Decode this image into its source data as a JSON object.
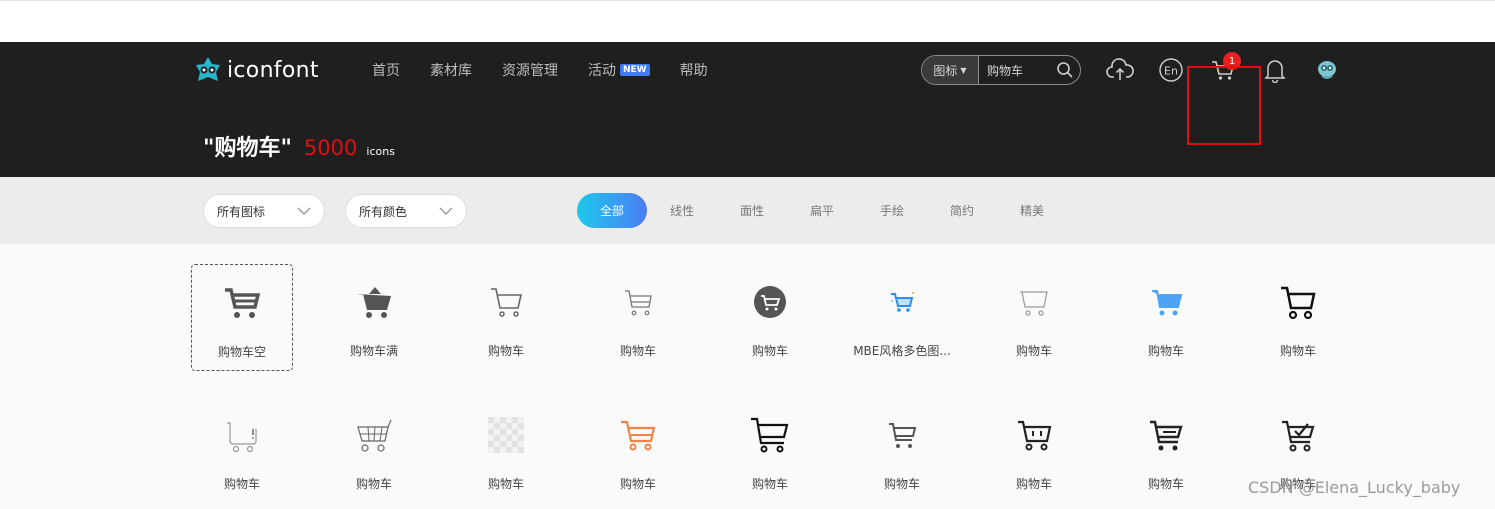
{
  "header": {
    "logo_text": "iconfont",
    "nav": [
      {
        "label": "首页"
      },
      {
        "label": "素材库"
      },
      {
        "label": "资源管理"
      },
      {
        "label": "活动",
        "badge": "NEW"
      },
      {
        "label": "帮助"
      }
    ],
    "search": {
      "type_label": "图标",
      "value": "购物车"
    },
    "icons": [
      "upload-icon",
      "language-en-icon",
      "cart-icon",
      "bell-icon",
      "avatar"
    ],
    "cart_count": "1",
    "language_label": "En"
  },
  "query": {
    "term": "\"购物车\"",
    "count": "5000",
    "unit": "icons"
  },
  "filters": {
    "dropdown_icons": "所有图标",
    "dropdown_colors": "所有颜色",
    "tabs": [
      {
        "label": "全部",
        "active": true
      },
      {
        "label": "线性"
      },
      {
        "label": "面性"
      },
      {
        "label": "扁平"
      },
      {
        "label": "手绘"
      },
      {
        "label": "简约"
      },
      {
        "label": "精美"
      }
    ]
  },
  "results": [
    {
      "name": "购物车空",
      "icon": "cart-empty-icon"
    },
    {
      "name": "购物车满",
      "icon": "cart-full-icon"
    },
    {
      "name": "购物车",
      "icon": "cart-outline-icon"
    },
    {
      "name": "购物车",
      "icon": "cart-thin-icon"
    },
    {
      "name": "购物车",
      "icon": "cart-circle-icon"
    },
    {
      "name": "MBE风格多色图...",
      "icon": "cart-mbe-icon"
    },
    {
      "name": "购物车",
      "icon": "cart-light-icon"
    },
    {
      "name": "购物车",
      "icon": "cart-blue-icon"
    },
    {
      "name": "购物车",
      "icon": "cart-bold-icon"
    },
    {
      "name": "购物车",
      "icon": "cart-info-icon"
    },
    {
      "name": "购物车",
      "icon": "cart-grid-icon"
    },
    {
      "name": "购物车",
      "icon": "cart-transparent-icon"
    },
    {
      "name": "购物车",
      "icon": "cart-orange-icon"
    },
    {
      "name": "购物车",
      "icon": "cart-black-icon"
    },
    {
      "name": "购物车",
      "icon": "cart-gray-icon"
    },
    {
      "name": "购物车",
      "icon": "cart-face-icon"
    },
    {
      "name": "购物车",
      "icon": "cart-lines-icon"
    },
    {
      "name": "购物车",
      "icon": "cart-check-icon"
    }
  ],
  "watermark": "CSDN @Elena_Lucky_baby",
  "colors": {
    "header_bg": "#1f1f1f",
    "accent_red": "#e01010",
    "tab_gradient_start": "#1ec8ec",
    "tab_gradient_end": "#4c7cf4"
  }
}
